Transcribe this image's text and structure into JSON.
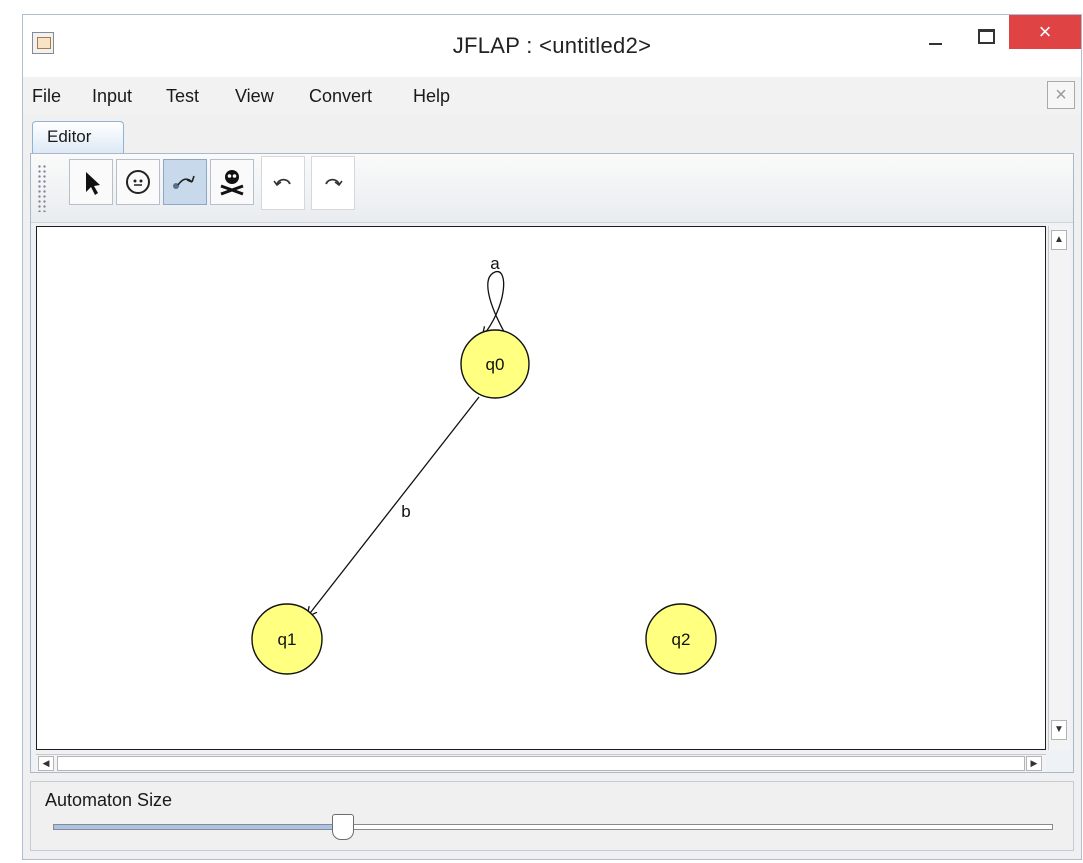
{
  "window": {
    "title": "JFLAP : <untitled2>",
    "close_glyph": "×"
  },
  "menu": {
    "items": [
      "File",
      "Input",
      "Test",
      "View",
      "Convert",
      "Help"
    ],
    "close_glyph": "×"
  },
  "tabs": [
    {
      "label": "Editor",
      "active": true
    }
  ],
  "toolbar": {
    "tools": [
      {
        "name": "attribute-editor",
        "icon": "arrow-cursor-icon"
      },
      {
        "name": "state-creator",
        "icon": "state-circle-icon"
      },
      {
        "name": "transition-creator",
        "icon": "transition-arrow-icon",
        "active": true
      },
      {
        "name": "deleter",
        "icon": "skull-crossbones-icon"
      },
      {
        "name": "undo",
        "icon": "undo-icon"
      },
      {
        "name": "redo",
        "icon": "redo-icon"
      }
    ]
  },
  "automaton": {
    "state_color": "#ffff80",
    "states": [
      {
        "id": "q0",
        "label": "q0"
      },
      {
        "id": "q1",
        "label": "q1"
      },
      {
        "id": "q2",
        "label": "q2"
      }
    ],
    "transitions": [
      {
        "from": "q0",
        "to": "q0",
        "label": "a"
      },
      {
        "from": "q0",
        "to": "q1",
        "label": "b"
      }
    ]
  },
  "size_panel": {
    "label": "Automaton Size",
    "value_fraction": 0.29
  },
  "scroll": {
    "up_glyph": "▲",
    "down_glyph": "▼",
    "left_glyph": "◀",
    "right_glyph": "▶"
  }
}
